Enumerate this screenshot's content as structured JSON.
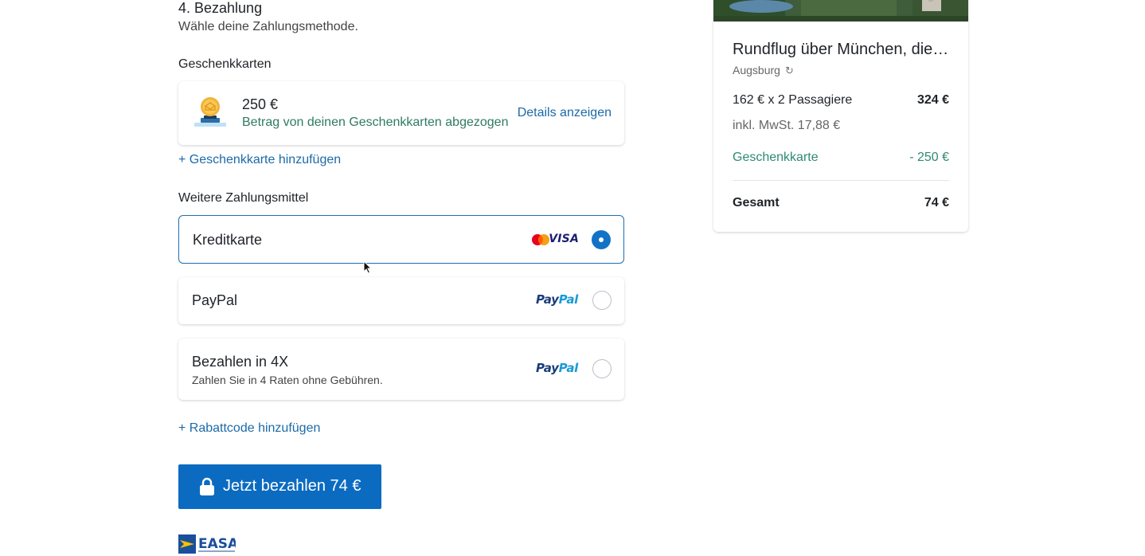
{
  "payment": {
    "step_title": "4. Bezahlung",
    "step_subtitle": "Wähle deine Zahlungsmethode.",
    "gift_section_label": "Geschenkkarten",
    "gift_card": {
      "amount": "250 €",
      "note": "Betrag von deinen Geschenkkarten abgezogen",
      "details_link": "Details anzeigen"
    },
    "add_gift_card": "+ Geschenkkarte hinzufügen",
    "other_methods_label": "Weitere Zahlungsmittel",
    "methods": [
      {
        "label": "Kreditkarte",
        "sub": "",
        "selected": true,
        "logos": [
          "mastercard-icon",
          "visa-icon"
        ],
        "visa_text": "VISA"
      },
      {
        "label": "PayPal",
        "sub": "",
        "selected": false,
        "logo_text_a": "Pay",
        "logo_text_b": "Pal"
      },
      {
        "label": "Bezahlen in 4X",
        "sub": "Zahlen Sie in 4 Raten ohne Gebühren.",
        "selected": false,
        "logo_text_a": "Pay",
        "logo_text_b": "Pal"
      }
    ],
    "add_discount_code": "+ Rabattcode hinzufügen",
    "pay_button": "Jetzt bezahlen 74 €",
    "easa_logo_text": "EASA"
  },
  "summary": {
    "title": "Rundflug über München, die…",
    "location": "Augsburg",
    "price_line_label": "162 € x 2 Passagiere",
    "price_line_value": "324 €",
    "tax_label": "inkl. MwSt.  17,88 €",
    "gift_label": "Geschenkkarte",
    "gift_value": "- 250 €",
    "total_label": "Gesamt",
    "total_value": "74 €"
  },
  "colors": {
    "accent": "#0b6bc1",
    "link": "#1c6aa8",
    "success": "#2f7a64"
  }
}
